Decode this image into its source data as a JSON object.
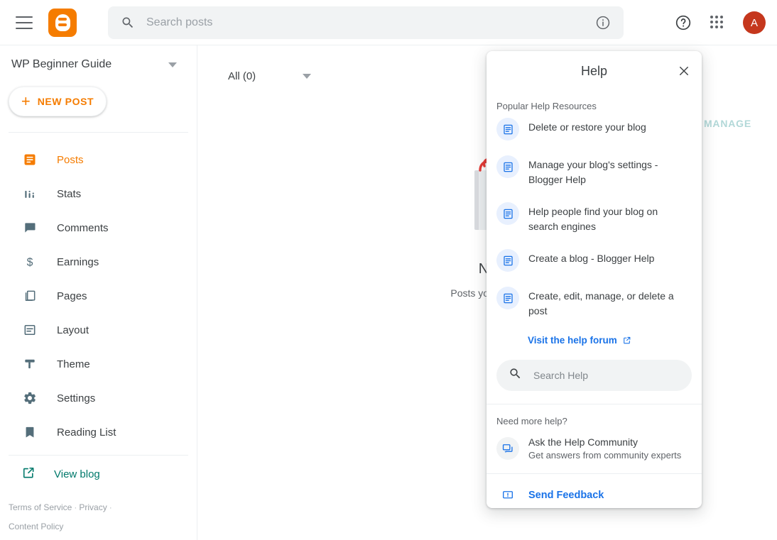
{
  "topbar": {
    "menu_icon": "hamburger-menu-icon",
    "logo_icon": "blogger-logo-icon",
    "search": {
      "icon": "search-icon",
      "value": "",
      "placeholder": "Search posts",
      "info_icon": "info-icon"
    },
    "help_icon": "help-circle-icon",
    "apps_icon": "apps-grid-icon",
    "avatar_letter": "A"
  },
  "sidebar": {
    "blog_title": "WP Beginner Guide",
    "blog_switcher_icon": "chevron-down-icon",
    "new_post": {
      "label": "NEW POST",
      "plus": "+"
    },
    "items": [
      {
        "label": "Posts",
        "icon": "posts-icon",
        "active": true
      },
      {
        "label": "Stats",
        "icon": "stats-bar-icon",
        "active": false
      },
      {
        "label": "Comments",
        "icon": "comment-icon",
        "active": false
      },
      {
        "label": "Earnings",
        "icon": "dollar-icon",
        "active": false
      },
      {
        "label": "Pages",
        "icon": "pages-icon",
        "active": false
      },
      {
        "label": "Layout",
        "icon": "layout-icon",
        "active": false
      },
      {
        "label": "Theme",
        "icon": "theme-brush-icon",
        "active": false
      },
      {
        "label": "Settings",
        "icon": "gear-icon",
        "active": false
      },
      {
        "label": "Reading List",
        "icon": "bookmark-icon",
        "active": false
      }
    ],
    "view_blog": {
      "label": "View blog",
      "icon": "external-link-icon"
    },
    "legal": {
      "terms": "Terms of Service",
      "privacy": "Privacy",
      "content_policy": "Content Policy",
      "separator": "·"
    }
  },
  "main": {
    "filter_label": "All (0)",
    "filter_icon": "chevron-down-icon",
    "manage_label": "MANAGE",
    "empty_state": {
      "illustration": "pencil-and-paper-icon",
      "title": "No",
      "subtitle": "Posts you create"
    }
  },
  "help_panel": {
    "title": "Help",
    "close_icon": "close-icon",
    "popular_label": "Popular Help Resources",
    "resources": [
      {
        "label": "Delete or restore your blog",
        "icon": "article-doc-icon"
      },
      {
        "label": "Manage your blog's settings - Blogger Help",
        "icon": "article-doc-icon"
      },
      {
        "label": "Help people find your blog on search engines",
        "icon": "article-doc-icon"
      },
      {
        "label": "Create a blog - Blogger Help",
        "icon": "article-doc-icon"
      },
      {
        "label": "Create, edit, manage, or delete a post",
        "icon": "article-doc-icon"
      }
    ],
    "forum_link": {
      "label": "Visit the help forum",
      "icon": "external-link-icon"
    },
    "search": {
      "icon": "search-icon",
      "value": "",
      "placeholder": "Search Help"
    },
    "need_more_help_label": "Need more help?",
    "ask_community": {
      "title": "Ask the Help Community",
      "subtitle": "Get answers from community experts",
      "icon": "community-forum-icon"
    },
    "send_feedback": {
      "label": "Send Feedback",
      "icon": "feedback-icon"
    }
  },
  "colors": {
    "brand_orange": "#f57c00",
    "link_blue": "#1a73e8",
    "teal": "#00796b",
    "manage_teal": "#b2d8d8",
    "avatar_red": "#c5371d",
    "text_primary": "#3c4043",
    "text_secondary": "#5f6368",
    "chip_grey": "#f1f3f4",
    "badge_blue_bg": "#e8f0fe"
  }
}
